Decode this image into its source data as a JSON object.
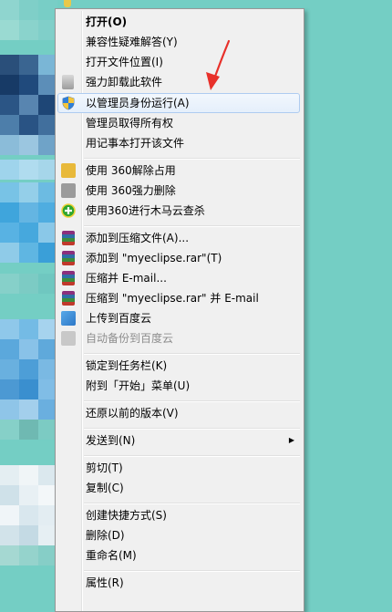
{
  "menu": {
    "items": [
      {
        "label": "打开(O)",
        "name": "menu-open",
        "bold": true
      },
      {
        "label": "兼容性疑难解答(Y)",
        "name": "menu-troubleshoot-compatibility"
      },
      {
        "label": "打开文件位置(I)",
        "name": "menu-open-file-location"
      },
      {
        "label": "强力卸载此软件",
        "name": "menu-force-uninstall",
        "icon": "recycle-bin-icon"
      },
      {
        "label": "以管理员身份运行(A)",
        "name": "menu-run-as-admin",
        "icon": "uac-shield-icon",
        "highlight": true
      },
      {
        "label": "管理员取得所有权",
        "name": "menu-take-ownership"
      },
      {
        "label": "用记事本打开该文件",
        "name": "menu-open-with-notepad"
      },
      {
        "label": "使用 360解除占用",
        "name": "menu-360-unlock",
        "icon": "360-unlock-icon"
      },
      {
        "label": "使用 360强力删除",
        "name": "menu-360-force-delete",
        "icon": "360-shredder-icon"
      },
      {
        "label": "使用360进行木马云查杀",
        "name": "menu-360-trojan-scan",
        "icon": "360-antivirus-icon"
      },
      {
        "label": "添加到压缩文件(A)...",
        "name": "menu-add-to-archive",
        "icon": "winrar-icon"
      },
      {
        "label": "添加到 \"myeclipse.rar\"(T)",
        "name": "menu-add-to-myeclipse-rar",
        "icon": "winrar-icon"
      },
      {
        "label": "压缩并 E-mail...",
        "name": "menu-compress-and-email",
        "icon": "winrar-icon"
      },
      {
        "label": "压缩到 \"myeclipse.rar\" 并 E-mail",
        "name": "menu-compress-to-rar-and-email",
        "icon": "winrar-icon"
      },
      {
        "label": "上传到百度云",
        "name": "menu-upload-baidu-cloud",
        "icon": "baidu-cloud-icon"
      },
      {
        "label": "自动备份到百度云",
        "name": "menu-auto-backup-baidu-cloud",
        "icon": "baidu-cloud-icon",
        "disabled": true
      },
      {
        "label": "锁定到任务栏(K)",
        "name": "menu-pin-to-taskbar"
      },
      {
        "label": "附到「开始」菜单(U)",
        "name": "menu-pin-to-start"
      },
      {
        "label": "还原以前的版本(V)",
        "name": "menu-restore-previous-versions"
      },
      {
        "label": "发送到(N)",
        "name": "menu-send-to",
        "submenu": true
      },
      {
        "label": "剪切(T)",
        "name": "menu-cut"
      },
      {
        "label": "复制(C)",
        "name": "menu-copy"
      },
      {
        "label": "创建快捷方式(S)",
        "name": "menu-create-shortcut"
      },
      {
        "label": "删除(D)",
        "name": "menu-delete"
      },
      {
        "label": "重命名(M)",
        "name": "menu-rename"
      },
      {
        "label": "属性(R)",
        "name": "menu-properties"
      }
    ]
  },
  "colors": {
    "desktop": "#74cec4",
    "menu_bg": "#f0f0f0",
    "highlight_border": "#aeccf0",
    "annotation": "#e8302a"
  }
}
